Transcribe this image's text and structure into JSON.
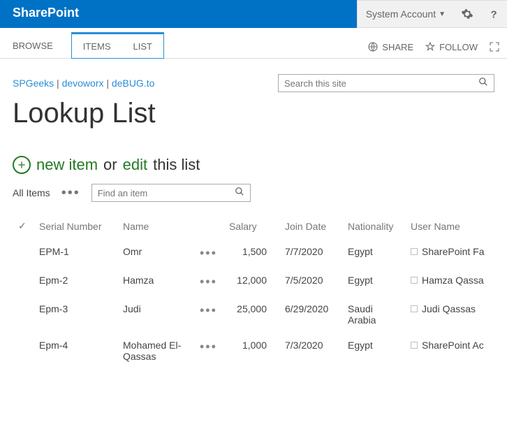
{
  "suitebar": {
    "brand": "SharePoint",
    "account": "System Account"
  },
  "ribbon": {
    "browse": "BROWSE",
    "items": "ITEMS",
    "list": "LIST",
    "share": "SHARE",
    "follow": "FOLLOW"
  },
  "breadcrumbs": {
    "a": "SPGeeks",
    "b": "devoworx",
    "c": "deBUG.to",
    "sep": " | "
  },
  "search": {
    "placeholder": "Search this site"
  },
  "page_title": "Lookup List",
  "actions": {
    "new_item": "new item",
    "or": "or",
    "edit": "edit",
    "this_list": "this list"
  },
  "view": {
    "name": "All Items",
    "find_placeholder": "Find an item"
  },
  "table": {
    "headers": {
      "serial": "Serial Number",
      "name": "Name",
      "salary": "Salary",
      "join": "Join Date",
      "nat": "Nationality",
      "user": "User Name"
    },
    "rows": [
      {
        "serial": "EPM-1",
        "name": "Omr",
        "salary": "1,500",
        "join": "7/7/2020",
        "nat": "Egypt",
        "user": "SharePoint Fa"
      },
      {
        "serial": "Epm-2",
        "name": "Hamza",
        "salary": "12,000",
        "join": "7/5/2020",
        "nat": "Egypt",
        "user": "Hamza Qassa"
      },
      {
        "serial": "Epm-3",
        "name": "Judi",
        "salary": "25,000",
        "join": "6/29/2020",
        "nat": "Saudi Arabia",
        "user": "Judi Qassas"
      },
      {
        "serial": "Epm-4",
        "name": "Mohamed El-Qassas",
        "salary": "1,000",
        "join": "7/3/2020",
        "nat": "Egypt",
        "user": "SharePoint Ac"
      }
    ]
  }
}
